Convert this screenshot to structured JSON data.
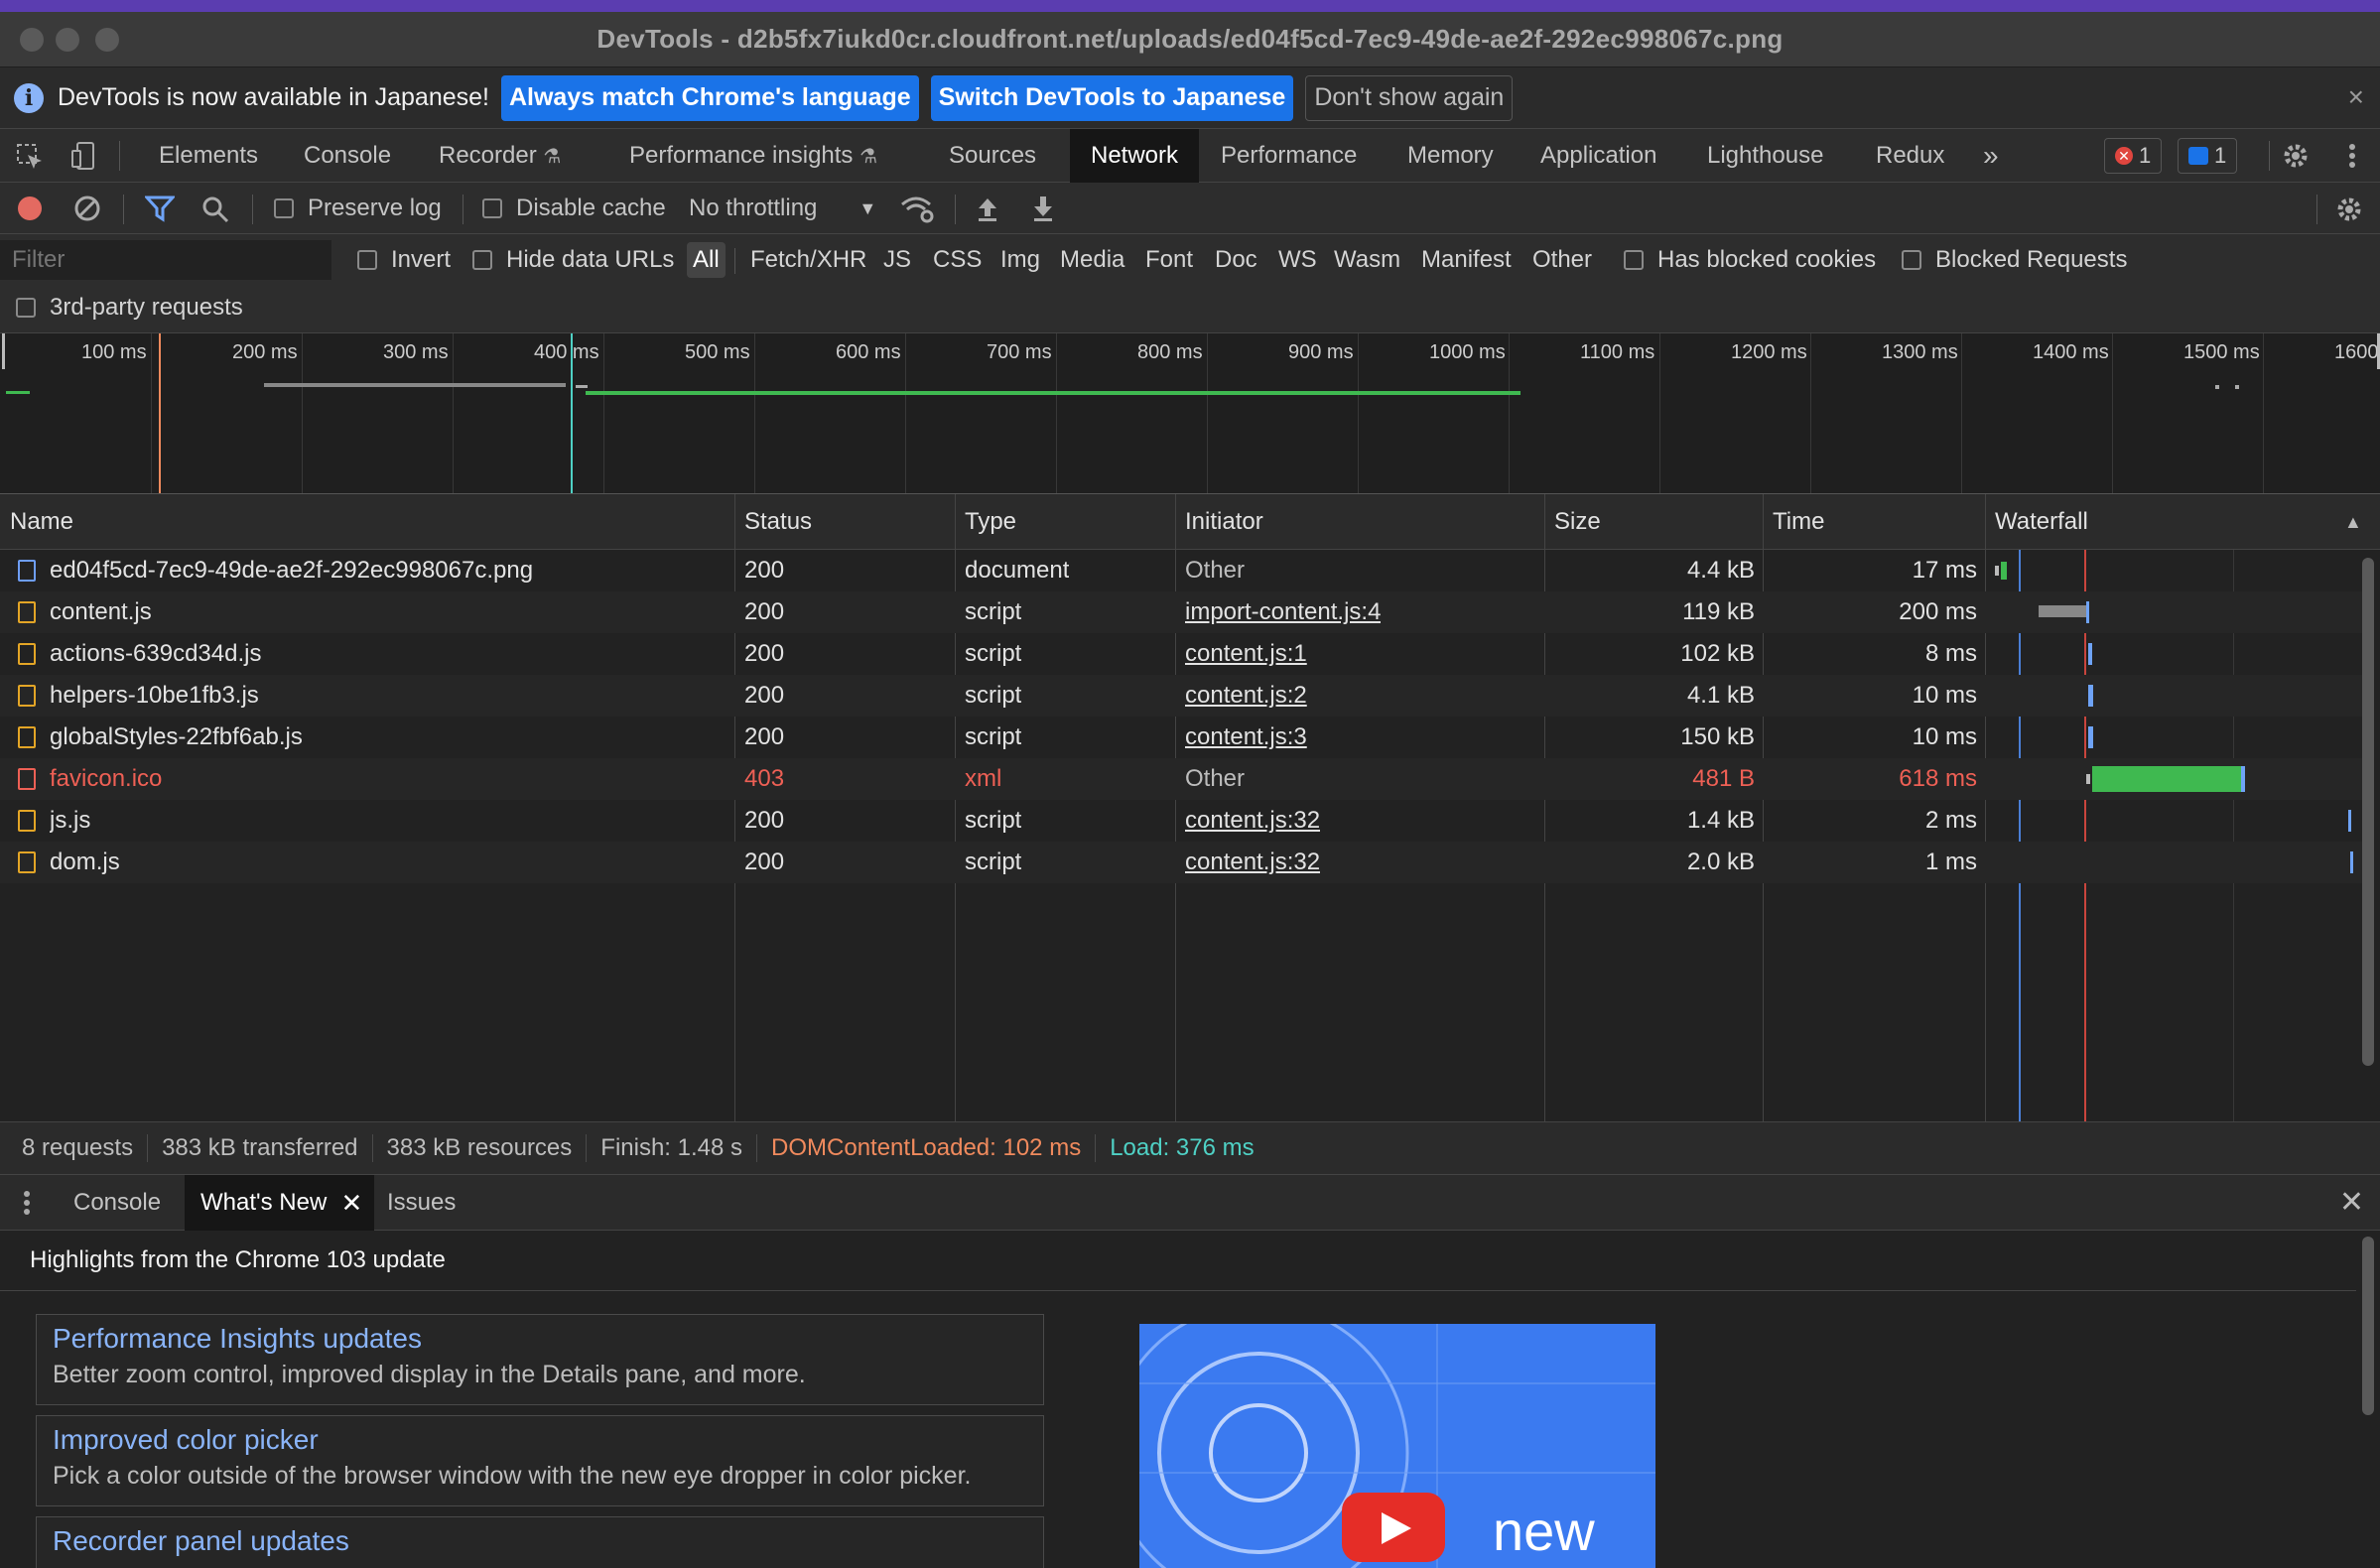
{
  "window": {
    "title": "DevTools - d2b5fx7iukd0cr.cloudfront.net/uploads/ed04f5cd-7ec9-49de-ae2f-292ec998067c.png"
  },
  "infobar": {
    "message": "DevTools is now available in Japanese!",
    "btn_match": "Always match Chrome's language",
    "btn_switch": "Switch DevTools to Japanese",
    "btn_dismiss": "Don't show again",
    "close": "×"
  },
  "tabs": {
    "elements": "Elements",
    "console": "Console",
    "recorder": "Recorder",
    "perf_insights": "Performance insights",
    "sources": "Sources",
    "network": "Network",
    "performance": "Performance",
    "memory": "Memory",
    "application": "Application",
    "lighthouse": "Lighthouse",
    "redux": "Redux",
    "more": "»",
    "error_count": "1",
    "message_count": "1"
  },
  "toolbar": {
    "preserve_log": "Preserve log",
    "disable_cache": "Disable cache",
    "throttling": "No throttling"
  },
  "filterbar": {
    "filter_placeholder": "Filter",
    "invert": "Invert",
    "hide_data_urls": "Hide data URLs",
    "types": [
      "All",
      "Fetch/XHR",
      "JS",
      "CSS",
      "Img",
      "Media",
      "Font",
      "Doc",
      "WS",
      "Wasm",
      "Manifest",
      "Other"
    ],
    "blocked_cookies": "Has blocked cookies",
    "blocked_requests": "Blocked Requests",
    "third_party": "3rd-party requests"
  },
  "overview": {
    "ticks": [
      "100 ms",
      "200 ms",
      "300 ms",
      "400 ms",
      "500 ms",
      "600 ms",
      "700 ms",
      "800 ms",
      "900 ms",
      "1000 ms",
      "1100 ms",
      "1200 ms",
      "1300 ms",
      "1400 ms",
      "1500 ms",
      "1600"
    ]
  },
  "columns": {
    "name": "Name",
    "status": "Status",
    "type": "Type",
    "initiator": "Initiator",
    "size": "Size",
    "time": "Time",
    "waterfall": "Waterfall"
  },
  "requests": [
    {
      "name": "ed04f5cd-7ec9-49de-ae2f-292ec998067c.png",
      "status": "200",
      "type": "document",
      "initiator": "Other",
      "size": "4.4 kB",
      "time": "17 ms"
    },
    {
      "name": "content.js",
      "status": "200",
      "type": "script",
      "initiator": "import-content.js:4",
      "size": "119 kB",
      "time": "200 ms"
    },
    {
      "name": "actions-639cd34d.js",
      "status": "200",
      "type": "script",
      "initiator": "content.js:1",
      "size": "102 kB",
      "time": "8 ms"
    },
    {
      "name": "helpers-10be1fb3.js",
      "status": "200",
      "type": "script",
      "initiator": "content.js:2",
      "size": "4.1 kB",
      "time": "10 ms"
    },
    {
      "name": "globalStyles-22fbf6ab.js",
      "status": "200",
      "type": "script",
      "initiator": "content.js:3",
      "size": "150 kB",
      "time": "10 ms"
    },
    {
      "name": "favicon.ico",
      "status": "403",
      "type": "xml",
      "initiator": "Other",
      "size": "481 B",
      "time": "618 ms"
    },
    {
      "name": "js.js",
      "status": "200",
      "type": "script",
      "initiator": "content.js:32",
      "size": "1.4 kB",
      "time": "2 ms"
    },
    {
      "name": "dom.js",
      "status": "200",
      "type": "script",
      "initiator": "content.js:32",
      "size": "2.0 kB",
      "time": "1 ms"
    }
  ],
  "summary": {
    "requests": "8 requests",
    "transferred": "383 kB transferred",
    "resources": "383 kB resources",
    "finish": "Finish: 1.48 s",
    "dcl": "DOMContentLoaded: 102 ms",
    "load": "Load: 376 ms"
  },
  "drawer": {
    "tab_console": "Console",
    "tab_whats_new": "What's New",
    "tab_issues": "Issues",
    "headline": "Highlights from the Chrome 103 update",
    "cards": [
      {
        "title": "Performance Insights updates",
        "desc": "Better zoom control, improved display in the Details pane, and more."
      },
      {
        "title": "Improved color picker",
        "desc": "Pick a color outside of the browser window with the new eye dropper in color picker."
      },
      {
        "title": "Recorder panel updates",
        "desc": ""
      }
    ],
    "video_text": "new"
  },
  "colors": {
    "accent": "#1a73e8",
    "dcl": "#f08a5d",
    "load": "#4fd1c5",
    "error": "#ee6055"
  }
}
